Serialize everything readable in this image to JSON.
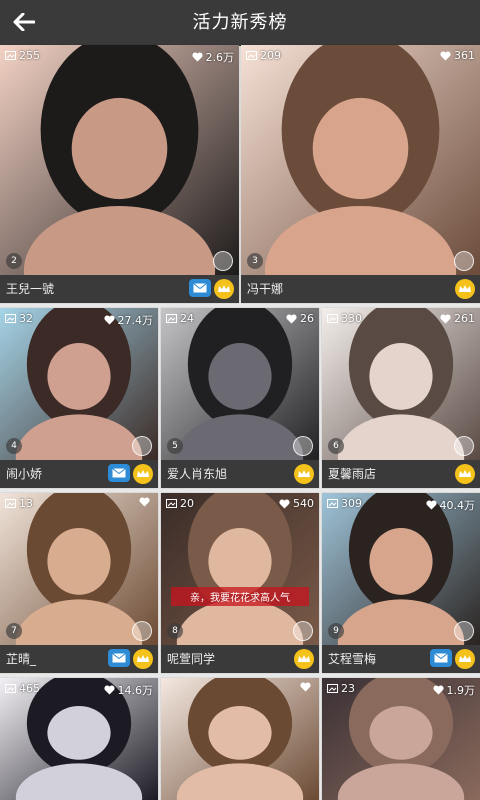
{
  "header": {
    "title": "活力新秀榜",
    "back_icon": "back-arrow-icon"
  },
  "cards": [
    {
      "photos": "255",
      "likes": "2.6万",
      "rank": "2",
      "name": "王兒一號",
      "mail": true,
      "vip": true
    },
    {
      "photos": "209",
      "likes": "361",
      "rank": "3",
      "name": "冯干娜",
      "mail": false,
      "vip": true
    },
    {
      "photos": "32",
      "likes": "27.4万",
      "rank": "4",
      "name": "闹小娇",
      "mail": true,
      "vip": true
    },
    {
      "photos": "24",
      "likes": "26",
      "rank": "5",
      "name": "爱人肖东旭",
      "mail": false,
      "vip": true
    },
    {
      "photos": "330",
      "likes": "261",
      "rank": "6",
      "name": "夏馨雨店",
      "mail": false,
      "vip": true
    },
    {
      "photos": "13",
      "likes": "",
      "rank": "7",
      "name": "芷晴_",
      "mail": true,
      "vip": true
    },
    {
      "photos": "20",
      "likes": "540",
      "rank": "8",
      "name": "呢萱同学",
      "mail": false,
      "vip": true
    },
    {
      "photos": "309",
      "likes": "40.4万",
      "rank": "9",
      "name": "艾程雪梅",
      "mail": true,
      "vip": true
    },
    {
      "photos": "465",
      "likes": "14.6万",
      "rank": "",
      "name": "",
      "mail": false,
      "vip": false
    },
    {
      "photos": "",
      "likes": "",
      "rank": "",
      "name": "",
      "mail": false,
      "vip": false
    },
    {
      "photos": "23",
      "likes": "1.9万",
      "rank": "",
      "name": "",
      "mail": false,
      "vip": false
    }
  ],
  "overlay_text": "亲，我要花花求高人气",
  "colors": {
    "bar": "#3a3a3a",
    "vip": "#f4c21a",
    "mail": "#2e8bd6"
  }
}
